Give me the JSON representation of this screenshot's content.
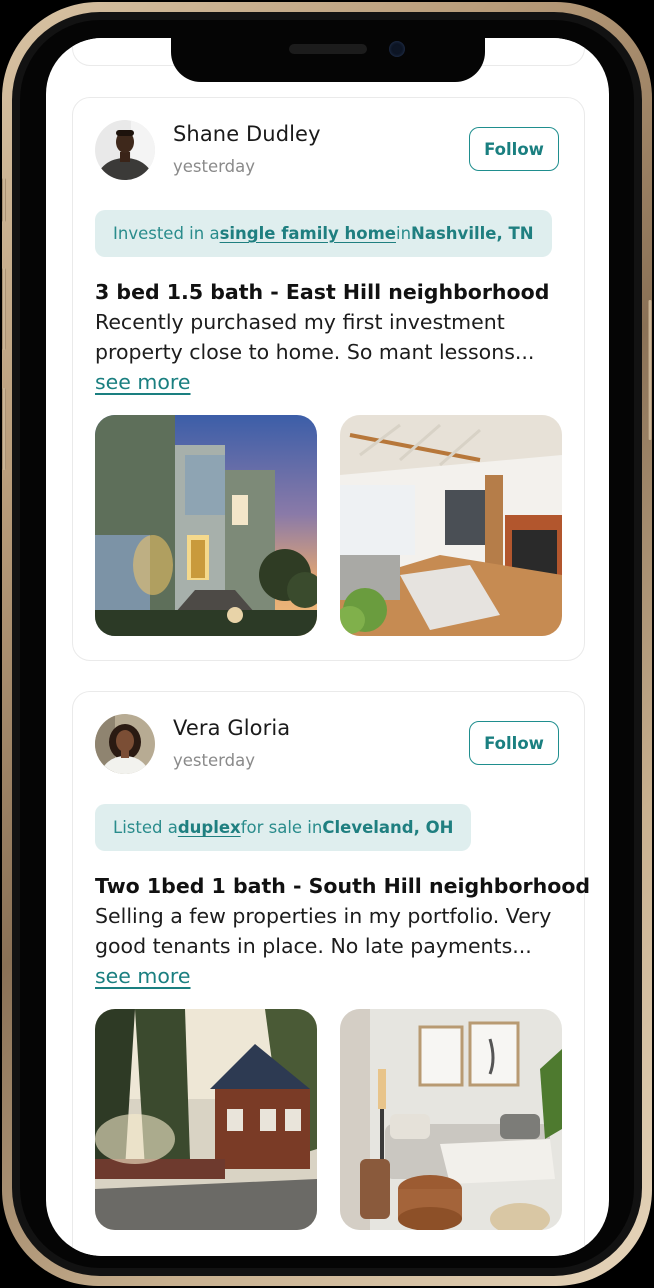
{
  "feed": {
    "posts": [
      {
        "user": {
          "name": "Shane Dudley",
          "timestamp": "yesterday"
        },
        "follow_label": "Follow",
        "activity": {
          "prefix": "Invested in a ",
          "link": "single family home",
          "middle": " in ",
          "location": "Nashville, TN"
        },
        "title": "3 bed 1.5 bath - East Hill neighborhood",
        "body_lines": [
          "Recently purchased my first investment",
          "property close to home. So mant lessons..."
        ],
        "see_more": "see more"
      },
      {
        "user": {
          "name": "Vera Gloria",
          "timestamp": "yesterday"
        },
        "follow_label": "Follow",
        "activity": {
          "prefix": "Listed a ",
          "link": "duplex",
          "middle": " for sale in ",
          "location": "Cleveland, OH"
        },
        "title": "Two 1bed 1 bath - South Hill neighborhood",
        "body_lines": [
          "Selling a few properties in my portfolio. Very",
          "good tenants in place. No late payments..."
        ],
        "see_more": "see more"
      }
    ]
  },
  "colors": {
    "accent": "#1f8e8e",
    "pill_bg": "#dfeeee",
    "frame_gold": "#c8b08f"
  }
}
